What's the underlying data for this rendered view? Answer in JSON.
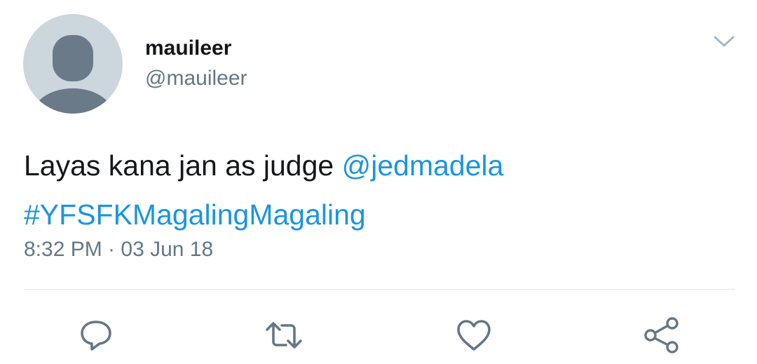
{
  "user": {
    "display_name": "mauileer",
    "handle": "@mauileer"
  },
  "tweet": {
    "text": "Layas kana jan as judge ",
    "mention": "@jedmadela",
    "hashtag": "#YFSFKMagalingMagaling",
    "timestamp": "8:32 PM · 03 Jun 18"
  },
  "actions": {
    "reply_icon": "reply-icon",
    "retweet_icon": "retweet-icon",
    "like_icon": "heart-icon",
    "share_icon": "share-icon"
  },
  "colors": {
    "link": "#1b95e0",
    "secondary_text": "#657786",
    "avatar_bg": "#ccd6dd",
    "avatar_fg": "#6b7a88",
    "icon": "#657786"
  }
}
